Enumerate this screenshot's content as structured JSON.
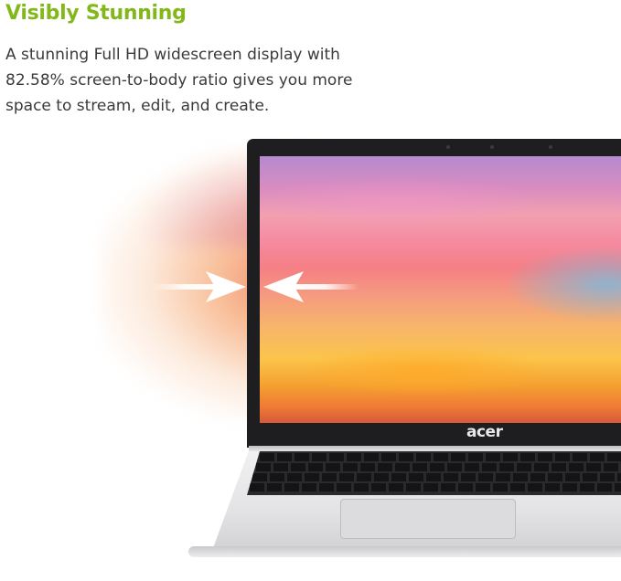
{
  "headline": "Visibly Stunning",
  "description": "A stunning Full HD widescreen display with 82.58% screen-to-body ratio gives you more space to stream, edit, and create.",
  "laptop": {
    "brand_logo": "acer"
  },
  "icons": {
    "left_arrow": "arrow-right-icon",
    "right_arrow": "arrow-left-icon"
  },
  "colors": {
    "headline": "#83b81a",
    "text": "#3a3a3a",
    "bezel": "#1e1e20"
  }
}
